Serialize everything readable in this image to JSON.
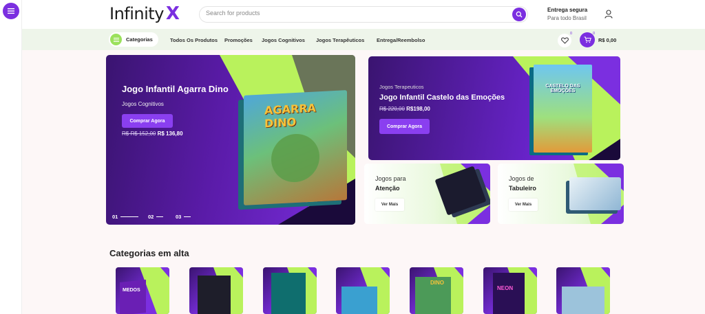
{
  "header": {
    "logo_text": "Infinity",
    "logo_mark": "X",
    "search_placeholder": "Search for products",
    "delivery_title": "Entrega segura",
    "delivery_sub": "Para todo Brasil"
  },
  "nav": {
    "categories_label": "Categorias",
    "links": [
      "Todos Os Produtos",
      "Promoções",
      "Jogos Cognitivos",
      "Jogos Terapêuticos",
      "Entrega/Reembolso"
    ],
    "wishlist_count": "0",
    "cart_count": "0",
    "cart_total": "R$ 0,00"
  },
  "hero": {
    "title": "Jogo Infantil Agarra Dino",
    "category": "Jogos Cognitivos",
    "button": "Comprar Agora",
    "old_price": "R$ R$ 152,00",
    "new_price": "R$ 136,80",
    "slides": [
      "01",
      "02",
      "03"
    ],
    "box_title": "AGARRA DINO"
  },
  "promo_top": {
    "category": "Jogos Terapeuticos",
    "title": "Jogo Infantil Castelo das Emoções",
    "old_price": "R$ 220,00",
    "new_price": "R$198,00",
    "button": "Comprar Agora",
    "box_title": "CASTELO DAS EMOÇÕES"
  },
  "promo_small": [
    {
      "line1": "Jogos para",
      "line2": "Atenção",
      "button": "Ver Mais"
    },
    {
      "line1": "Jogos de",
      "line2": "Tabuleiro",
      "button": "Ver Mais"
    }
  ],
  "categories_title": "Categorias em alta",
  "category_tiles": [
    "MEDOS",
    "",
    "",
    "",
    "DINO",
    "NEON",
    ""
  ],
  "colors": {
    "purple": "#7b2fe0",
    "lime": "#b9f25c",
    "dark_purple": "#3a1470"
  }
}
